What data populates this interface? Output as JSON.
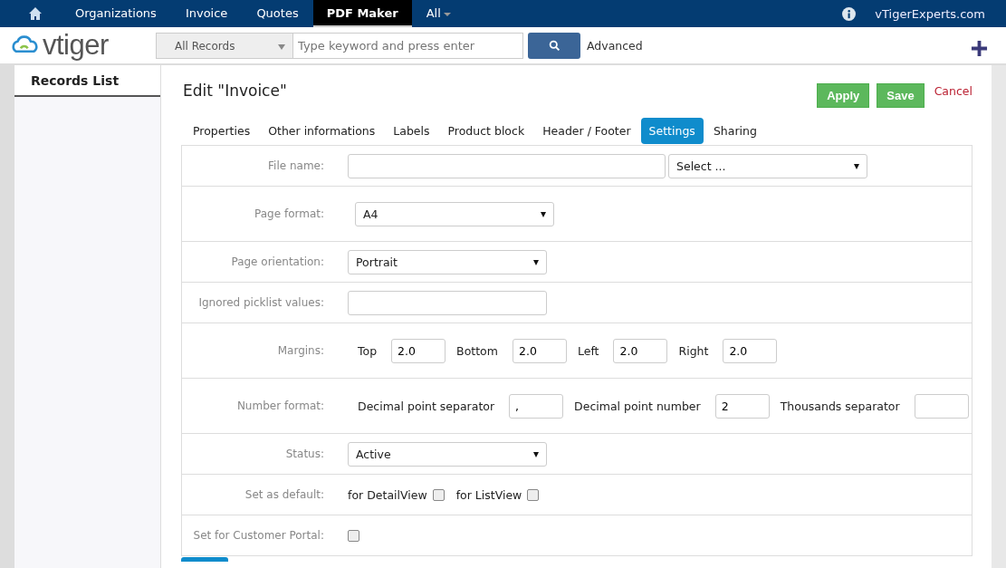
{
  "topnav": {
    "items": [
      {
        "label": "Organizations",
        "selected": false
      },
      {
        "label": "Invoice",
        "selected": false
      },
      {
        "label": "Quotes",
        "selected": false
      },
      {
        "label": "PDF Maker",
        "selected": true
      },
      {
        "label": "All",
        "selected": false
      }
    ],
    "user": "vTigerExperts.com"
  },
  "header": {
    "logo": "vtiger",
    "scope": "All Records",
    "search_placeholder": "Type keyword and press enter",
    "advanced": "Advanced"
  },
  "sidebar": {
    "title": "Records List"
  },
  "page": {
    "title": "Edit \"Invoice\"",
    "apply": "Apply",
    "save": "Save",
    "cancel": "Cancel"
  },
  "tabs": [
    {
      "label": "Properties",
      "selected": false
    },
    {
      "label": "Other informations",
      "selected": false
    },
    {
      "label": "Labels",
      "selected": false
    },
    {
      "label": "Product block",
      "selected": false
    },
    {
      "label": "Header / Footer",
      "selected": false
    },
    {
      "label": "Settings",
      "selected": true
    },
    {
      "label": "Sharing",
      "selected": false
    }
  ],
  "rows": [
    {
      "kind": "file",
      "label": "File name:",
      "select": "Select ..."
    },
    {
      "kind": "select",
      "label": "Page format:",
      "value": "A4"
    },
    {
      "kind": "select",
      "label": "Page orientation:",
      "value": "Portrait"
    },
    {
      "kind": "input",
      "label": "Ignored picklist values:"
    },
    {
      "kind": "pairs",
      "label": "Margins:",
      "pairs": [
        {
          "label": "Top",
          "value": "2.0"
        },
        {
          "label": "Bottom",
          "value": "2.0"
        },
        {
          "label": "Left",
          "value": "2.0"
        },
        {
          "label": "Right",
          "value": "2.0"
        }
      ]
    },
    {
      "kind": "pairs",
      "label": "Number format:",
      "pairs": [
        {
          "label": "Decimal point separator",
          "value": ","
        },
        {
          "label": "Decimal point number",
          "value": "2"
        },
        {
          "label": "Thousands separator"
        }
      ]
    },
    {
      "kind": "select",
      "label": "Status:",
      "value": "Active"
    },
    {
      "kind": "checks",
      "label": "Set as default:",
      "checks": [
        {
          "label": "for DetailView",
          "checked": false
        },
        {
          "label": "for ListView",
          "checked": false
        }
      ]
    },
    {
      "kind": "checks",
      "label": "Set for Customer Portal:",
      "checks": [
        {
          "checked": false
        }
      ]
    }
  ]
}
